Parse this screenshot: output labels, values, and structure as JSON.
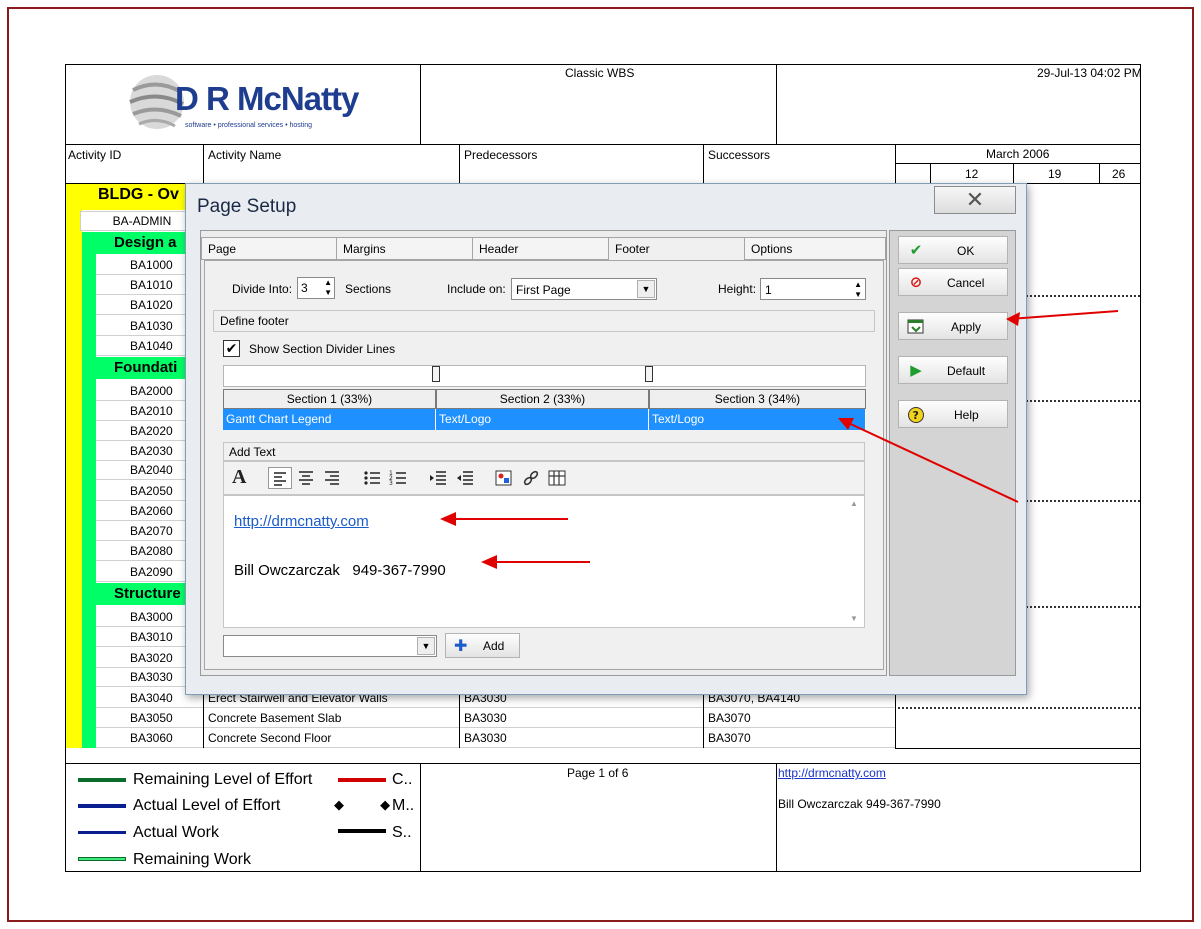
{
  "report": {
    "title": "Classic WBS",
    "datetime": "29-Jul-13 04:02 PM",
    "logo_text": "D R McNatty",
    "logo_tagline": "software • professional services • hosting",
    "columns": {
      "activity_id": "Activity ID",
      "activity_name": "Activity Name",
      "predecessors": "Predecessors",
      "successors": "Successors",
      "month": "March 2006",
      "days": [
        "12",
        "19",
        "26"
      ]
    },
    "groups": [
      {
        "label": "BLDG - Ov"
      },
      {
        "label": "Design a"
      },
      {
        "label": "Foundati"
      },
      {
        "label": "Structure"
      }
    ],
    "admin_row": "BA-ADMIN",
    "ids": {
      "design": [
        "BA1000",
        "BA1010",
        "BA1020",
        "BA1030",
        "BA1040"
      ],
      "foundation": [
        "BA2000",
        "BA2010",
        "BA2020",
        "BA2030",
        "BA2040",
        "BA2050",
        "BA2060",
        "BA2070",
        "BA2080",
        "BA2090"
      ],
      "structure": [
        "BA3000",
        "BA3010",
        "BA3020",
        "BA3030"
      ]
    },
    "rows": [
      {
        "id": "BA3040",
        "name": "Erect Stairwell and Elevator Walls",
        "pred": "BA3030",
        "succ": "BA3070, BA4140"
      },
      {
        "id": "BA3050",
        "name": "Concrete Basement Slab",
        "pred": "BA3030",
        "succ": "BA3070"
      },
      {
        "id": "BA3060",
        "name": "Concrete Second Floor",
        "pred": "BA3030",
        "succ": "BA3070"
      }
    ],
    "footer": {
      "page": "Page 1 of 6",
      "link": "http://drmcnatty.com",
      "contact": "Bill Owczarczak  949-367-7990",
      "legend": [
        {
          "label": "Remaining Level of Effort",
          "color": "#0a6b2a"
        },
        {
          "label": "Actual Level of Effort",
          "color": "#0a1f8f"
        },
        {
          "label": "Actual Work",
          "color": "#0a1f8f"
        },
        {
          "label": "Remaining Work",
          "color": "#3ee87a"
        }
      ],
      "legend_right": [
        "C..",
        "M..",
        "S.."
      ]
    }
  },
  "dialog": {
    "title": "Page Setup",
    "close_glyph": "✕",
    "tabs": [
      "Page",
      "Margins",
      "Header",
      "Footer",
      "Options"
    ],
    "active_tab": "Footer",
    "divide_label": "Divide Into:",
    "divide_value": "3",
    "sections_label": "Sections",
    "include_label": "Include on:",
    "include_value": "First Page",
    "height_label": "Height:",
    "height_value": "1",
    "define_label": "Define footer",
    "show_dividers_label": "Show Section Divider Lines",
    "show_dividers_checked": true,
    "section_headers": [
      "Section 1 (33%)",
      "Section 2 (33%)",
      "Section 3 (34%)"
    ],
    "section_values": [
      "Gantt Chart Legend",
      "Text/Logo",
      "Text/Logo"
    ],
    "add_text_label": "Add Text",
    "text_link": "http://drmcnatty.com",
    "text_contact": "Bill Owczarczak   949-367-7990",
    "add_button": "Add",
    "buttons": {
      "ok": "OK",
      "cancel": "Cancel",
      "apply": "Apply",
      "default": "Default",
      "help": "Help"
    }
  }
}
